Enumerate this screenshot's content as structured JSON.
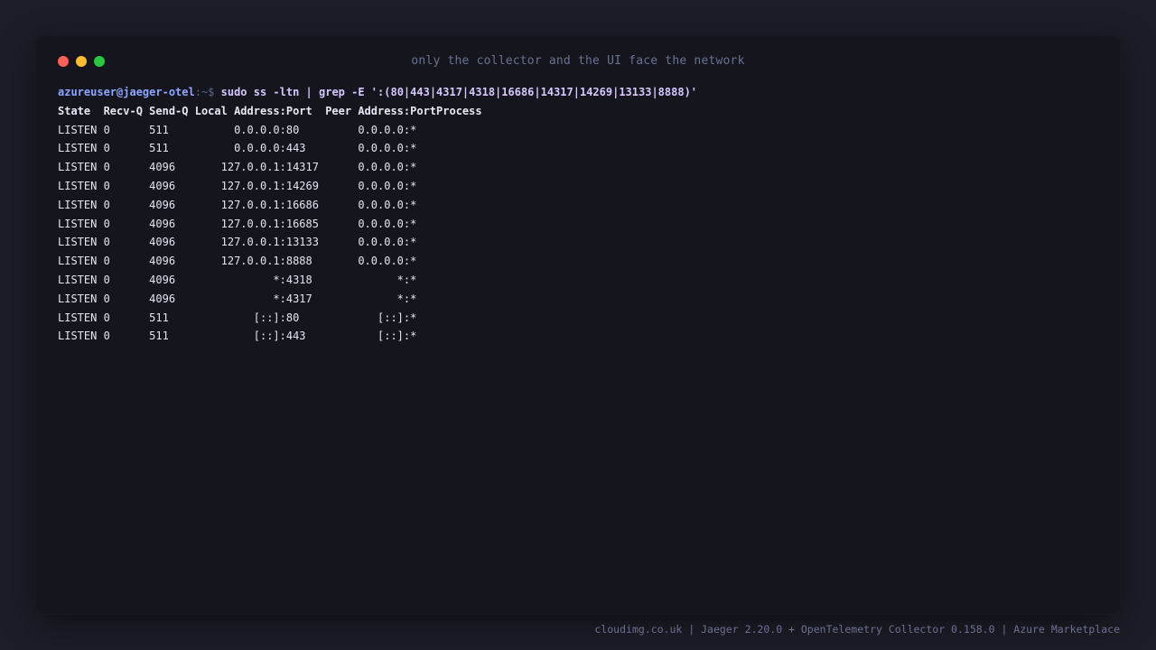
{
  "window": {
    "title": "only the collector and the UI face the network",
    "controls": [
      "close",
      "minimize",
      "maximize"
    ],
    "colors": {
      "close": "#ff5f57",
      "minimize": "#febc2e",
      "maximize": "#28c840"
    }
  },
  "terminal": {
    "prompt": {
      "user_host": "azureuser@jaeger-otel",
      "path": ":~$ ",
      "command": "sudo ss -ltn | grep -E ':(80|443|4317|4318|16686|14317|14269|13133|8888)'"
    },
    "header": "State  Recv-Q Send-Q Local Address:Port  Peer Address:PortProcess",
    "rows": [
      "LISTEN 0      511          0.0.0.0:80         0.0.0.0:*",
      "LISTEN 0      511          0.0.0.0:443        0.0.0.0:*",
      "LISTEN 0      4096       127.0.0.1:14317      0.0.0.0:*",
      "LISTEN 0      4096       127.0.0.1:14269      0.0.0.0:*",
      "LISTEN 0      4096       127.0.0.1:16686      0.0.0.0:*",
      "LISTEN 0      4096       127.0.0.1:16685      0.0.0.0:*",
      "LISTEN 0      4096       127.0.0.1:13133      0.0.0.0:*",
      "LISTEN 0      4096       127.0.0.1:8888       0.0.0.0:*",
      "LISTEN 0      4096               *:4318             *:*",
      "LISTEN 0      4096               *:4317             *:*",
      "LISTEN 0      511             [::]:80            [::]:*",
      "LISTEN 0      511             [::]:443           [::]:*"
    ]
  },
  "footer": {
    "text": "cloudimg.co.uk | Jaeger 2.20.0 + OpenTelemetry Collector 0.158.0 | Azure Marketplace"
  }
}
